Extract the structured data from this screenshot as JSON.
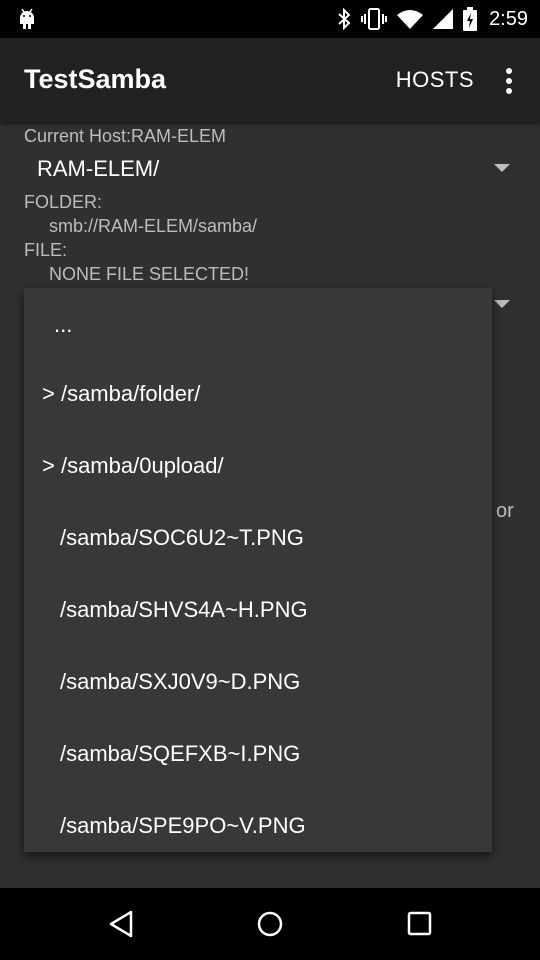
{
  "status_bar": {
    "time": "2:59",
    "icons": [
      "android-icon",
      "bluetooth-icon",
      "vibrate-icon",
      "wifi-icon",
      "signal-icon",
      "battery-icon"
    ]
  },
  "app_bar": {
    "title": "TestSamba",
    "hosts_label": "HOSTS",
    "overflow_icon": "overflow-menu-icon"
  },
  "main": {
    "current_host_label": "Current Host:RAM-ELEM",
    "host_spinner_value": "RAM-ELEM/",
    "folder_label": "FOLDER:",
    "folder_value": "smb://RAM-ELEM/samba/",
    "file_label": "FILE:",
    "file_value": "NONE FILE SELECTED!",
    "partial_text": "or"
  },
  "dropdown": {
    "items": [
      {
        "label": "..."
      },
      {
        "label": "> /samba/folder/"
      },
      {
        "label": "> /samba/0upload/"
      },
      {
        "label": "/samba/SOC6U2~T.PNG"
      },
      {
        "label": "/samba/SHVS4A~H.PNG"
      },
      {
        "label": "/samba/SXJ0V9~D.PNG"
      },
      {
        "label": "/samba/SQEFXB~I.PNG"
      },
      {
        "label": "/samba/SPE9PO~V.PNG"
      }
    ]
  },
  "nav_bar": {
    "icons": [
      "back-icon",
      "home-icon",
      "recents-icon"
    ]
  },
  "colors": {
    "background": "#303030",
    "app_bar": "#212121",
    "dropdown": "#383838",
    "secondary_text": "#bdbdbd"
  }
}
